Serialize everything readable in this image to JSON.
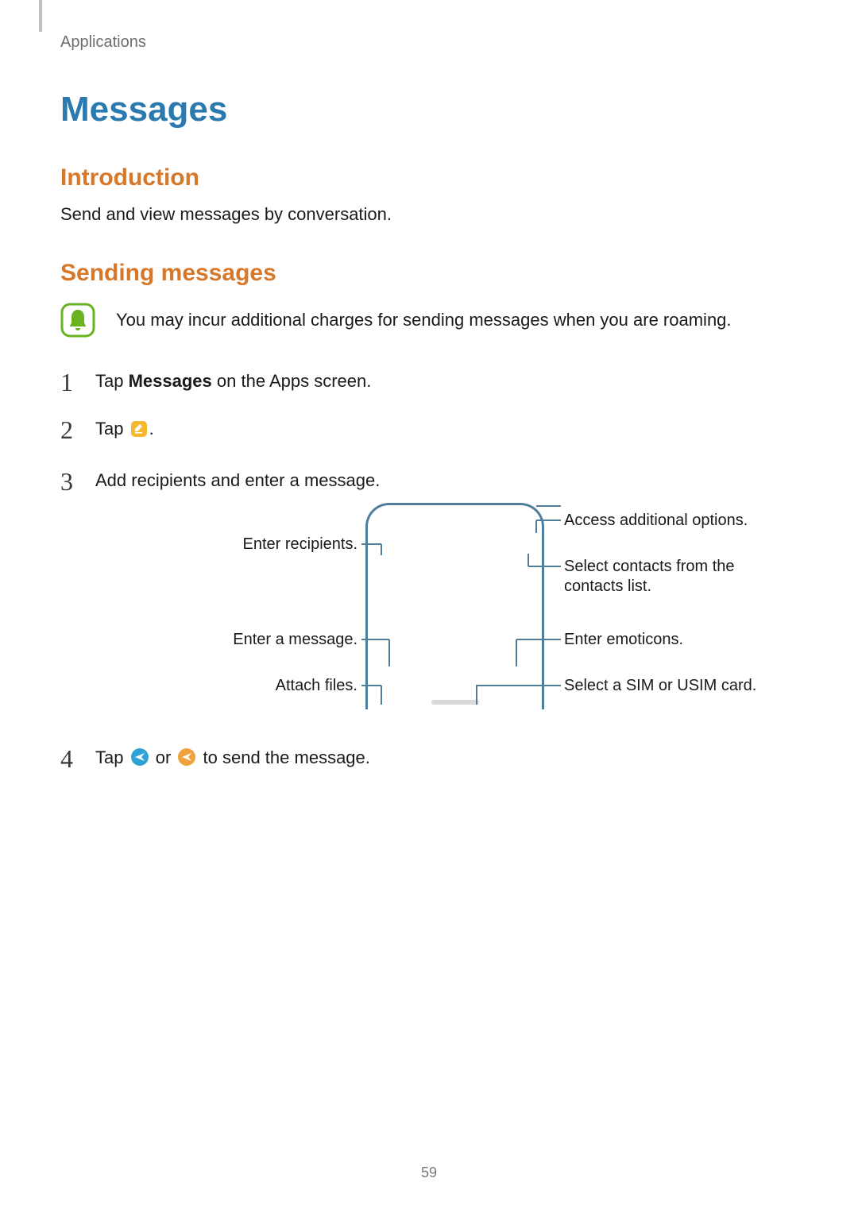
{
  "header": {
    "breadcrumb": "Applications"
  },
  "title": "Messages",
  "sections": {
    "intro": {
      "heading": "Introduction",
      "body": "Send and view messages by conversation."
    },
    "sending": {
      "heading": "Sending messages",
      "note": "You may incur additional charges for sending messages when you are roaming.",
      "steps": {
        "s1_pre": "Tap ",
        "s1_bold": "Messages",
        "s1_post": " on the Apps screen.",
        "s2_pre": "Tap ",
        "s2_post": ".",
        "s3": "Add recipients and enter a message.",
        "s4_pre": "Tap ",
        "s4_mid": " or ",
        "s4_post": " to send the message."
      },
      "callouts": {
        "left_recipients": "Enter recipients.",
        "left_message": "Enter a message.",
        "left_attach": "Attach files.",
        "right_options": "Access additional options.",
        "right_contacts": "Select contacts from the contacts list.",
        "right_emoticons": "Enter emoticons.",
        "right_sim": "Select a SIM or USIM card."
      }
    }
  },
  "page_number": "59",
  "palette": {
    "accent": "#2a7ab0",
    "heading": "#d7772a",
    "callout_green": "#69b321",
    "diagram_stroke": "#4f7e9b"
  },
  "icons": {
    "note": "bell-icon",
    "compose": "compose-icon",
    "send_blue": "send-blue-icon",
    "send_orange": "send-orange-icon"
  }
}
